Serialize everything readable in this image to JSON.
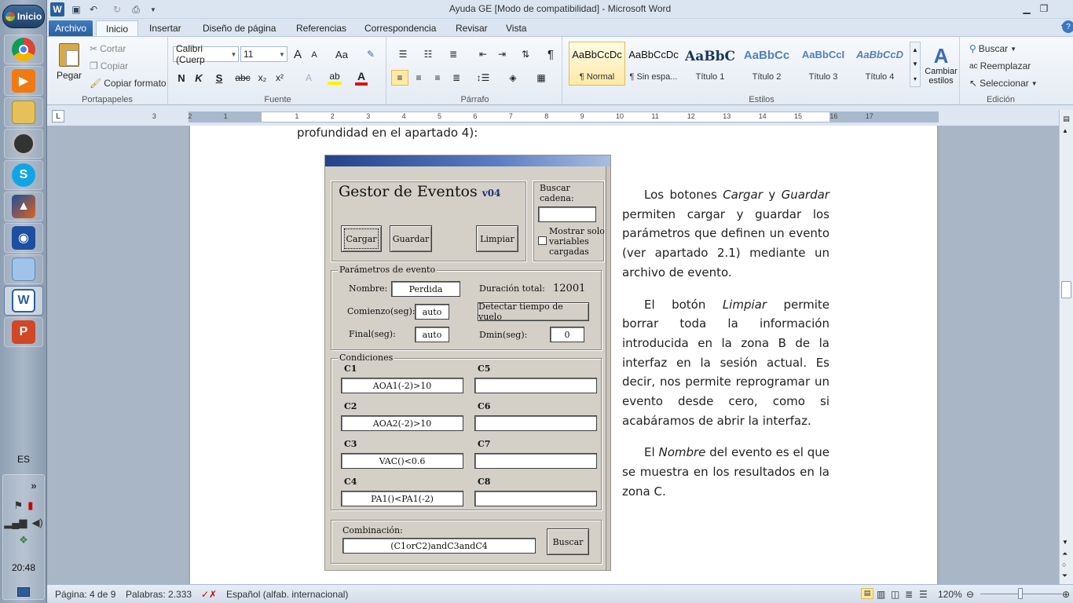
{
  "taskbar": {
    "start_label": "Inicio",
    "language": "ES",
    "tray_expand": "»",
    "clock": "20:48"
  },
  "window": {
    "title": "Ayuda GE [Modo de compatibilidad]  -  Microsoft Word",
    "app_icon": "W"
  },
  "tabs": [
    "Archivo",
    "Inicio",
    "Insertar",
    "Diseño de página",
    "Referencias",
    "Correspondencia",
    "Revisar",
    "Vista"
  ],
  "ribbon": {
    "clipboard": {
      "paste": "Pegar",
      "cut": "Cortar",
      "copy": "Copiar",
      "format_painter": "Copiar formato",
      "label": "Portapapeles"
    },
    "font": {
      "family": "Calibri (Cuerp",
      "size": "11",
      "grow": "A",
      "shrink": "A",
      "case": "Aa",
      "bold": "N",
      "italic": "K",
      "underline": "S",
      "strike": "abc",
      "sub": "x₂",
      "sup": "x²",
      "label": "Fuente"
    },
    "paragraph": {
      "pilcrow": "¶",
      "label": "Párrafo"
    },
    "styles": {
      "label": "Estilos",
      "tiles": [
        {
          "sample": "AaBbCcDc",
          "name": "¶ Normal"
        },
        {
          "sample": "AaBbCcDc",
          "name": "¶ Sin espa..."
        },
        {
          "sample": "AaBbC",
          "name": "Título 1"
        },
        {
          "sample": "AaBbCc",
          "name": "Título 2"
        },
        {
          "sample": "AaBbCcI",
          "name": "Título 3"
        },
        {
          "sample": "AaBbCcD",
          "name": "Título 4"
        }
      ],
      "change": "Cambiar estilos"
    },
    "editing": {
      "find": "Buscar",
      "replace": "Reemplazar",
      "select": "Seleccionar",
      "label": "Edición"
    }
  },
  "ruler": {
    "numbers": [
      "3",
      "2",
      "1",
      "1",
      "2",
      "3",
      "4",
      "5",
      "6",
      "7",
      "8",
      "9",
      "10",
      "11",
      "12",
      "13",
      "14",
      "15",
      "16",
      "17"
    ]
  },
  "document": {
    "top_line": "profundidad en el apartado 4):",
    "paragraphs": [
      [
        "Los botones ",
        "Cargar",
        " y ",
        "Guardar",
        " permiten cargar y guardar los parámetros que definen un evento (ver apartado 2.1) mediante un archivo de evento."
      ],
      [
        "El botón ",
        "Limpiar",
        " permite borrar toda la información introducida en la zona B de la interfaz en la sesión actual. Es decir, nos permite reprogramar un evento desde cero, como si acabáramos de abrir la interfaz."
      ],
      [
        "El ",
        "Nombre",
        " del evento es el que se muestra en los resultados en la zona C."
      ]
    ]
  },
  "ge": {
    "title": "Gestor de Eventos",
    "version": "v04",
    "buttons": {
      "load": "Cargar",
      "save": "Guardar",
      "clear": "Limpiar",
      "detect": "Detectar tiempo de vuelo",
      "search": "Buscar"
    },
    "search": {
      "label1": "Buscar",
      "label2": "cadena:",
      "value": "",
      "checkbox": "Mostrar solo",
      "checkbox2": "variables",
      "checkbox3": "cargadas"
    },
    "params": {
      "legend": "Parámetros de evento",
      "name_label": "Nombre:",
      "name_value": "Perdida",
      "duration_label": "Duración total:",
      "duration_value": "12001",
      "start_label": "Comienzo(seg):",
      "start_value": "auto",
      "end_label": "Final(seg):",
      "end_value": "auto",
      "dmin_label": "Dmin(seg):",
      "dmin_value": "0"
    },
    "conditions": {
      "legend": "Condiciones",
      "items": [
        {
          "label": "C1",
          "value": "AOA1(-2)>10"
        },
        {
          "label": "C2",
          "value": "AOA2(-2)>10"
        },
        {
          "label": "C3",
          "value": "VAC()<0.6"
        },
        {
          "label": "C4",
          "value": "PA1()<PA1(-2)"
        },
        {
          "label": "C5",
          "value": ""
        },
        {
          "label": "C6",
          "value": ""
        },
        {
          "label": "C7",
          "value": ""
        },
        {
          "label": "C8",
          "value": ""
        }
      ]
    },
    "combination": {
      "label": "Combinación:",
      "value": "(C1orC2)andC3andC4"
    }
  },
  "status": {
    "page": "Página: 4 de 9",
    "words": "Palabras: 2.333",
    "language": "Español (alfab. internacional)",
    "zoom": "120%"
  },
  "colors": {
    "file_tab": "#2a5f9e",
    "ge_titlebar": "#23428a"
  }
}
